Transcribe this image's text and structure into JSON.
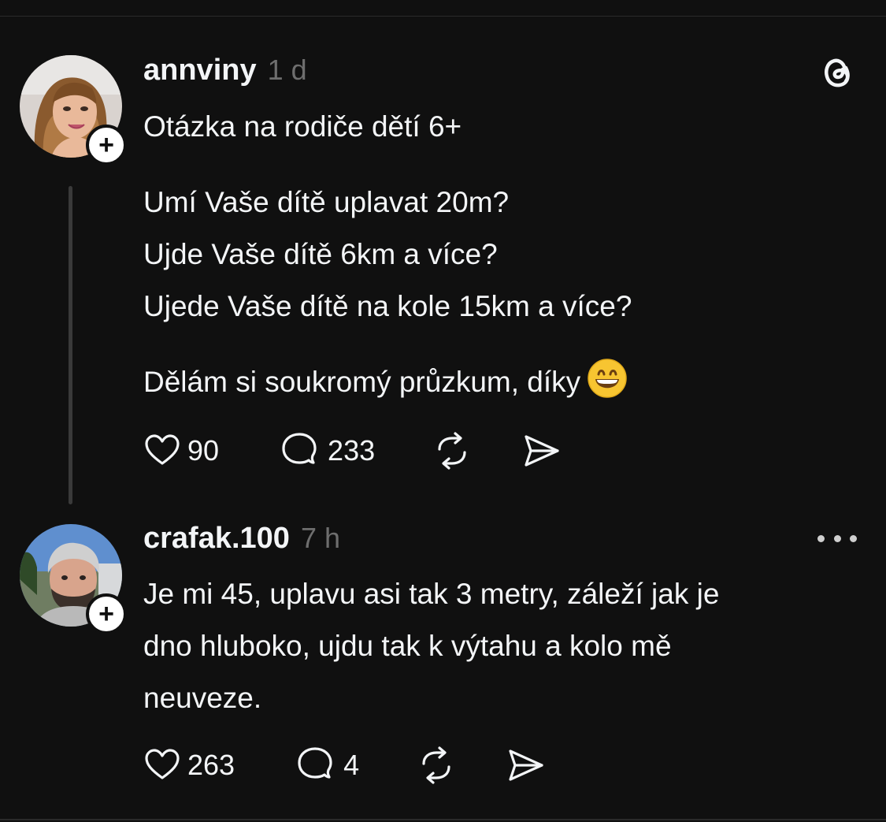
{
  "posts": [
    {
      "username": "annviny",
      "time": "1 d",
      "lines": [
        "Otázka na rodiče dětí 6+",
        "Umí Vaše dítě uplavat 20m?",
        "Ujde Vaše dítě 6km a více?",
        "Ujede Vaše dítě na kole 15km a více?",
        "Dělám si soukromý průzkum, díky"
      ],
      "likes": "90",
      "replies": "233"
    },
    {
      "username": "crafak.100",
      "time": "7 h",
      "lines": [
        "Je mi 45, uplavu asi tak 3 metry, záleží jak je",
        "dno hluboko, ujdu tak k výtahu a kolo mě",
        "neuveze."
      ],
      "likes": "263",
      "replies": "4"
    }
  ],
  "icons": {
    "brand": "threads-logo-icon",
    "like": "heart-icon",
    "reply": "comment-icon",
    "repost": "repost-icon",
    "share": "send-icon",
    "more": "more-dots-icon",
    "emoji": "grinning-face-emoji"
  },
  "colors": {
    "background": "#101010",
    "text": "#f3f5f7",
    "muted": "#6e6e6e",
    "thread_line": "#3a3a3a"
  }
}
